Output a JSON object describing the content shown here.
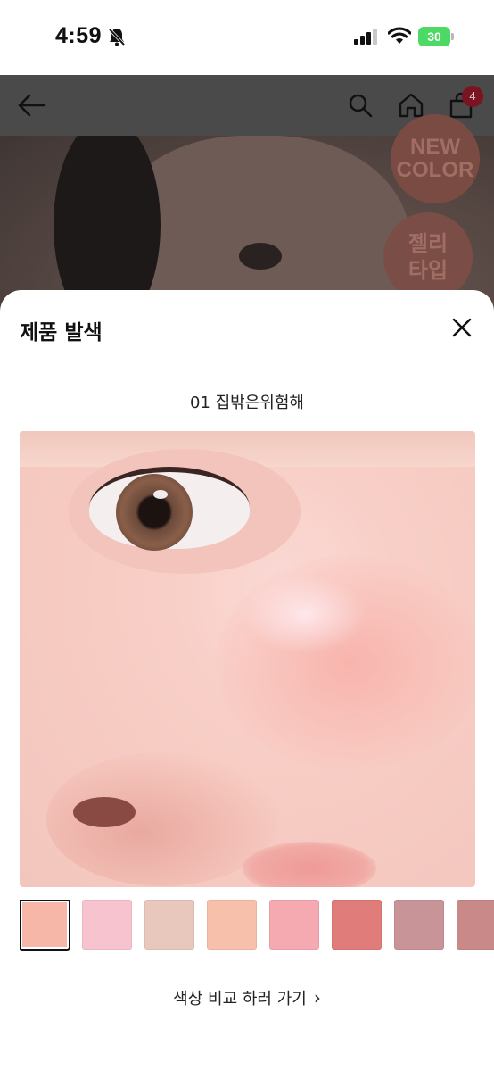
{
  "status_bar": {
    "time": "4:59",
    "battery_level": "30"
  },
  "header": {
    "cart_count": "4"
  },
  "hero": {
    "badge_new_line1": "NEW",
    "badge_new_line2": "COLOR",
    "badge_jelly_line1": "젤리",
    "badge_jelly_line2": "타입"
  },
  "sheet": {
    "title": "제품 발색",
    "shade_name": "01 집밖은위험해",
    "compare_link": "색상 비교 하러 가기",
    "swatches": [
      {
        "color": "#f6b6a8",
        "selected": true
      },
      {
        "color": "#f7c3cf",
        "selected": false
      },
      {
        "color": "#e8c8bc",
        "selected": false
      },
      {
        "color": "#f6c0aa",
        "selected": false
      },
      {
        "color": "#f5a9b0",
        "selected": false
      },
      {
        "color": "#e07c7a",
        "selected": false
      },
      {
        "color": "#c99498",
        "selected": false
      },
      {
        "color": "#c98988",
        "selected": false
      }
    ]
  },
  "colors": {
    "accent_badge": "#7a1420",
    "overlay": "#4a4a4a",
    "battery_green": "#4cd964"
  }
}
